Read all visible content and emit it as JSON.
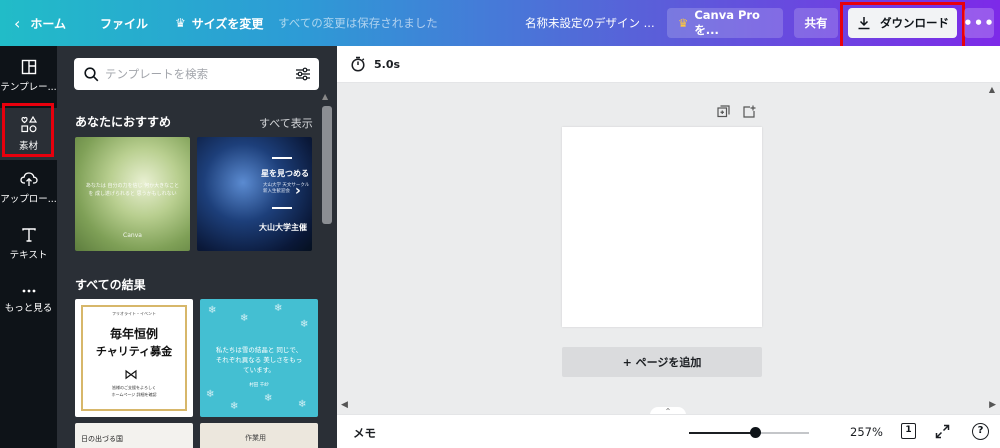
{
  "topbar": {
    "home_label": "ホーム",
    "file_label": "ファイル",
    "resize_label": "サイズを変更",
    "saved_status": "すべての変更は保存されました",
    "design_title": "名称未設定のデザイン ...",
    "pro_label": "Canva Proを...",
    "share_label": "共有",
    "download_label": "ダウンロード",
    "more_label": "•••",
    "gradient": [
      "#21bcc8",
      "#7d2ae8"
    ],
    "highlight_color": "#e8000d"
  },
  "rail": {
    "items": [
      {
        "label": "テンプレー...",
        "icon": "template-icon"
      },
      {
        "label": "素材",
        "icon": "elements-icon",
        "active": true
      },
      {
        "label": "アップロー...",
        "icon": "upload-cloud-icon"
      },
      {
        "label": "テキスト",
        "icon": "text-icon"
      },
      {
        "label": "もっと見る",
        "icon": "more-dots-icon"
      }
    ]
  },
  "panel": {
    "search_placeholder": "テンプレートを検索",
    "recommended_title": "あなたにおすすめ",
    "show_all": "すべて表示",
    "results_title": "すべての結果",
    "templates": {
      "t1_text": "あなたは 自分の力を信じ 何か大きなことを 成し遂げられると 思うかもしれない",
      "t1_sign": "Canva",
      "t2_title": "星を見つめる",
      "t2_small": "大山大学 天文サークル 新入生歓迎会",
      "t2_bottom": "大山大学主催",
      "t3_top": "フリオライト・イベント",
      "t3_line1": "毎年恒例",
      "t3_line2": "チャリティ募金",
      "t3_small1": "皆様のご支援をよろしく",
      "t3_small2": "ホームページ 詳細を確認",
      "t4_text": "私たちは雪の結晶と 同じで、それぞれ異なる 美しさをもっています。",
      "t4_sub": "村田 千紗",
      "t5_text": "日の出づる国",
      "t6_text": "作業用"
    }
  },
  "editor": {
    "duration": "5.0s",
    "add_page_label": "+ ページを追加",
    "memo_label": "メモ",
    "zoom": "257%",
    "zoom_fraction": 0.55,
    "page_count": "1",
    "help_label": "?"
  }
}
